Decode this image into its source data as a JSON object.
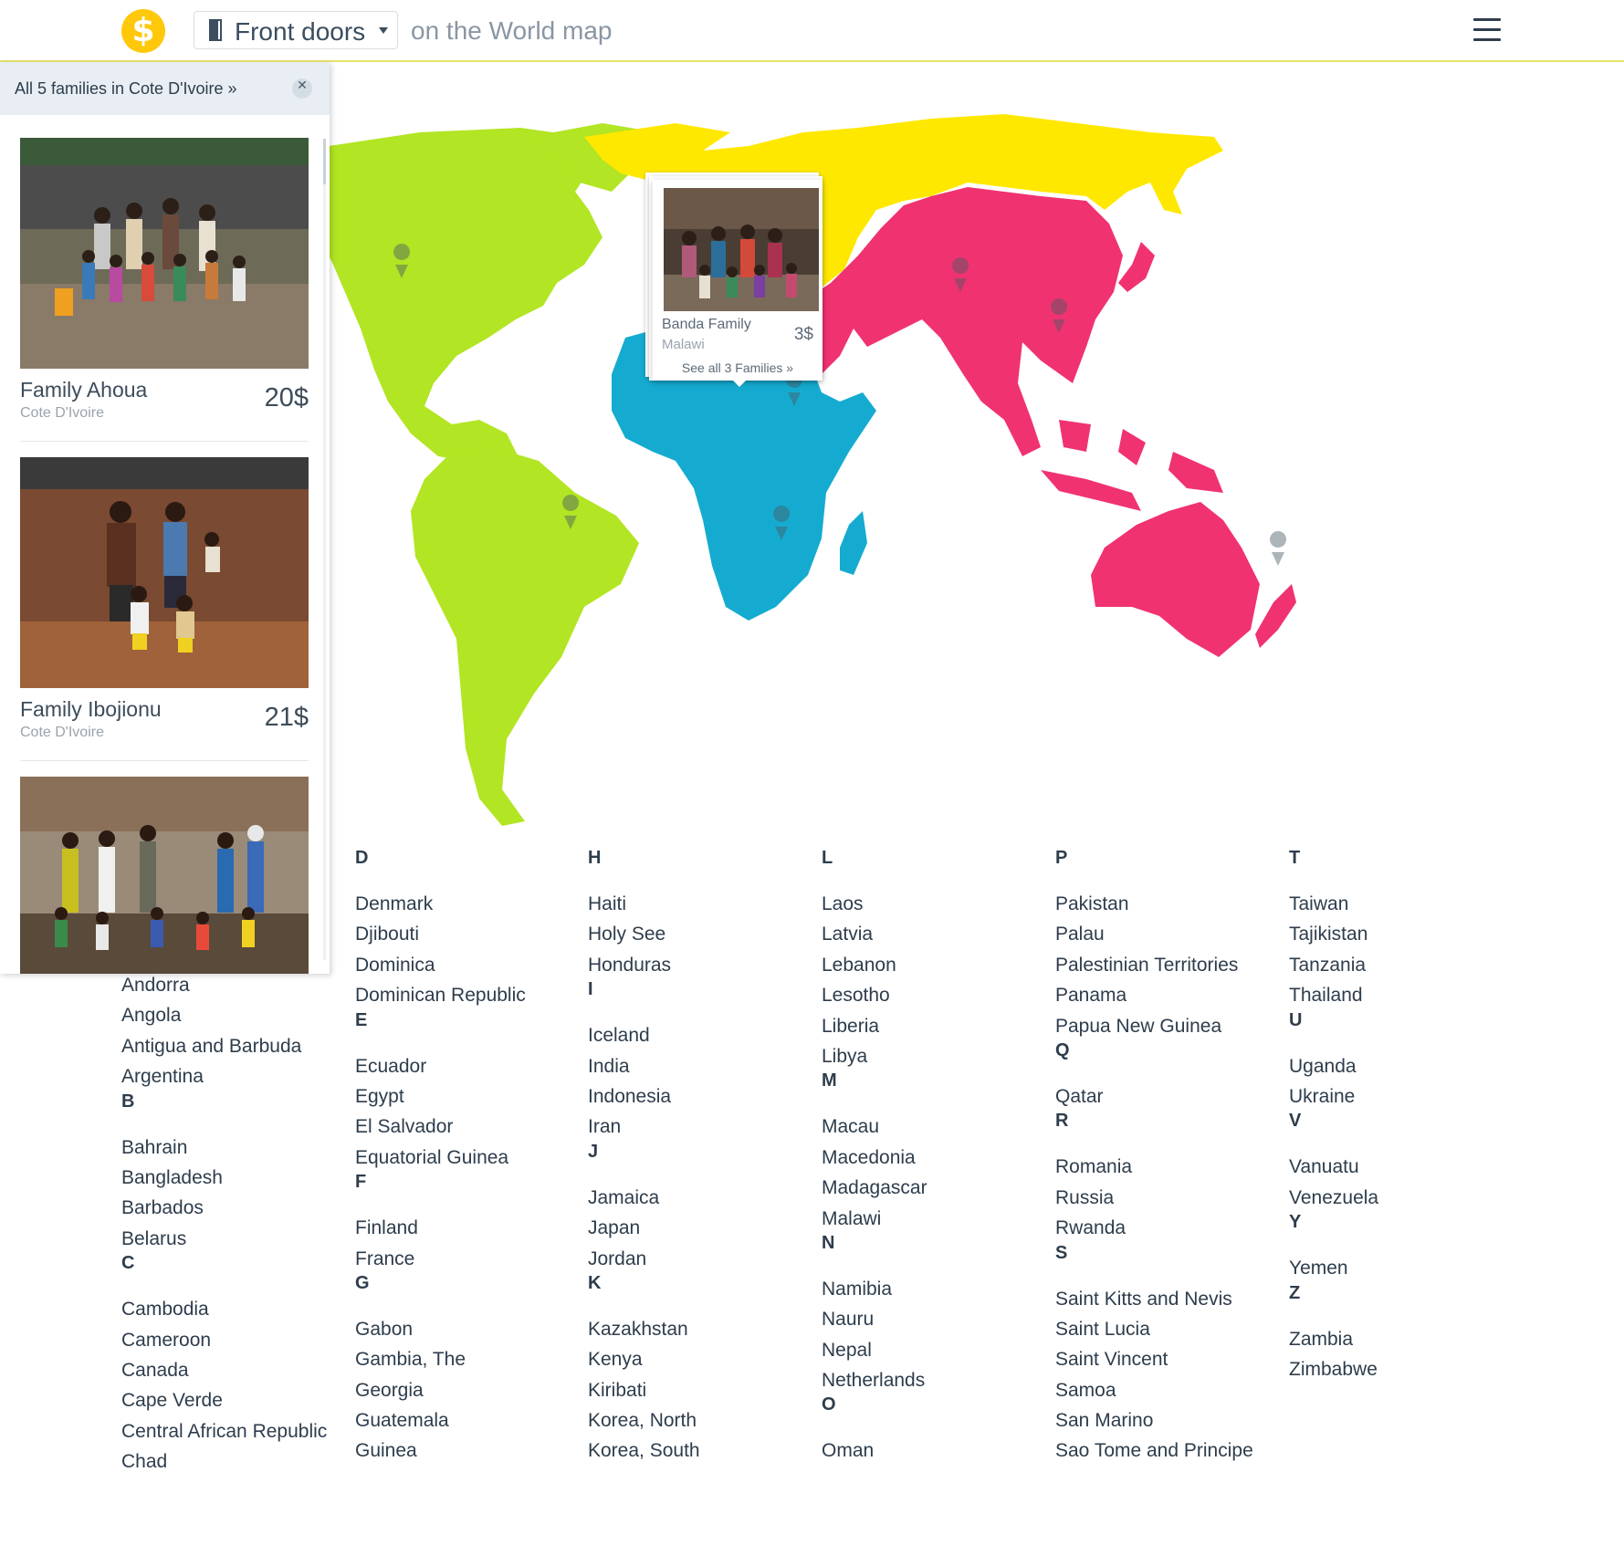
{
  "header": {
    "logo_symbol": "$",
    "selector_label": "Front doors",
    "subtitle": "on the World map",
    "menu_icon": "hamburger-icon",
    "accent_color": "#ffc80a"
  },
  "map": {
    "region_colors": {
      "americas": "#b2e523",
      "europe": "#ffe800",
      "africa": "#15abd0",
      "asia": "#f03271"
    },
    "popover": {
      "family_name": "Banda Family",
      "country": "Malawi",
      "income": "3$",
      "see_all": "See all 3 Families »"
    }
  },
  "side_panel": {
    "title": "All 5 families in Cote D'Ivoire »",
    "close_icon": "close-icon",
    "families": [
      {
        "name": "Family Ahoua",
        "country": "Cote D'Ivoire",
        "income": "20$"
      },
      {
        "name": "Family Ibojionu",
        "country": "Cote D'Ivoire",
        "income": "21$"
      }
    ]
  },
  "country_columns": [
    {
      "groups": [
        {
          "letter": "",
          "countries": [
            "Andorra",
            "Angola",
            "Antigua and Barbuda",
            "Argentina"
          ]
        },
        {
          "letter": "B",
          "countries": [
            "Bahrain",
            "Bangladesh",
            "Barbados",
            "Belarus"
          ]
        },
        {
          "letter": "C",
          "countries": [
            "Cambodia",
            "Cameroon",
            "Canada",
            "Cape Verde",
            "Central African Republic",
            "Chad"
          ]
        }
      ]
    },
    {
      "groups": [
        {
          "letter": "D",
          "countries": [
            "Denmark",
            "Djibouti",
            "Dominica",
            "Dominican Republic"
          ]
        },
        {
          "letter": "E",
          "countries": [
            "Ecuador",
            "Egypt",
            "El Salvador",
            "Equatorial Guinea"
          ]
        },
        {
          "letter": "F",
          "countries": [
            "Finland",
            "France"
          ]
        },
        {
          "letter": "G",
          "countries": [
            "Gabon",
            "Gambia, The",
            "Georgia",
            "Guatemala",
            "Guinea"
          ]
        }
      ]
    },
    {
      "groups": [
        {
          "letter": "H",
          "countries": [
            "Haiti",
            "Holy See",
            "Honduras"
          ]
        },
        {
          "letter": "I",
          "countries": [
            "Iceland",
            "India",
            "Indonesia",
            "Iran"
          ]
        },
        {
          "letter": "J",
          "countries": [
            "Jamaica",
            "Japan",
            "Jordan"
          ]
        },
        {
          "letter": "K",
          "countries": [
            "Kazakhstan",
            "Kenya",
            "Kiribati",
            "Korea, North",
            "Korea, South"
          ]
        }
      ]
    },
    {
      "groups": [
        {
          "letter": "L",
          "countries": [
            "Laos",
            "Latvia",
            "Lebanon",
            "Lesotho",
            "Liberia",
            "Libya"
          ]
        },
        {
          "letter": "M",
          "countries": [
            "Macau",
            "Macedonia",
            "Madagascar",
            "Malawi"
          ]
        },
        {
          "letter": "N",
          "countries": [
            "Namibia",
            "Nauru",
            "Nepal",
            "Netherlands"
          ]
        },
        {
          "letter": "O",
          "countries": [
            "Oman"
          ]
        }
      ]
    },
    {
      "groups": [
        {
          "letter": "P",
          "countries": [
            "Pakistan",
            "Palau",
            "Palestinian Territories",
            "Panama",
            "Papua New Guinea"
          ]
        },
        {
          "letter": "Q",
          "countries": [
            "Qatar"
          ]
        },
        {
          "letter": "R",
          "countries": [
            "Romania",
            "Russia",
            "Rwanda"
          ]
        },
        {
          "letter": "S",
          "countries": [
            "Saint Kitts and Nevis",
            "Saint Lucia",
            "Saint Vincent",
            "Samoa",
            "San Marino",
            "Sao Tome and Principe"
          ]
        }
      ]
    },
    {
      "groups": [
        {
          "letter": "T",
          "countries": [
            "Taiwan",
            "Tajikistan",
            "Tanzania",
            "Thailand"
          ]
        },
        {
          "letter": "U",
          "countries": [
            "Uganda",
            "Ukraine"
          ]
        },
        {
          "letter": "V",
          "countries": [
            "Vanuatu",
            "Venezuela"
          ]
        },
        {
          "letter": "Y",
          "countries": [
            "Yemen"
          ]
        },
        {
          "letter": "Z",
          "countries": [
            "Zambia",
            "Zimbabwe"
          ]
        }
      ]
    }
  ]
}
